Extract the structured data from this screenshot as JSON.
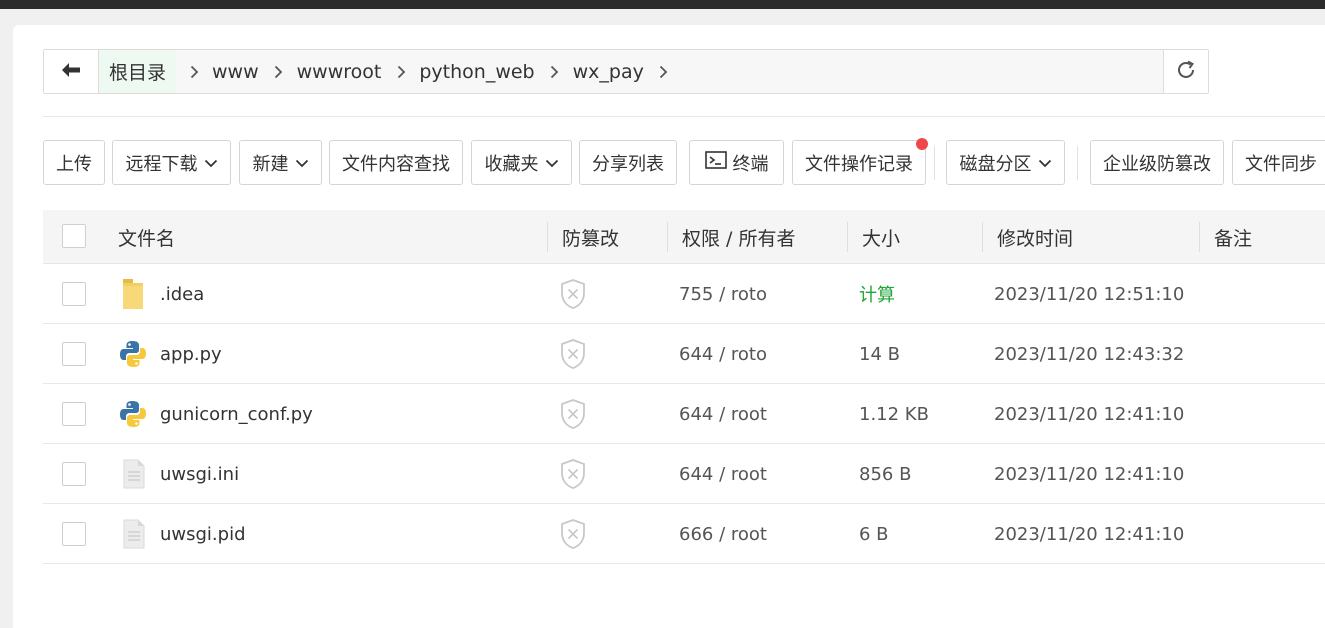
{
  "breadcrumb": {
    "items": [
      "根目录",
      "www",
      "wwwroot",
      "python_web",
      "wx_pay"
    ]
  },
  "toolbar": {
    "upload": "上传",
    "remote_download": "远程下载",
    "new": "新建",
    "content_search": "文件内容查找",
    "favorites": "收藏夹",
    "share_list": "分享列表",
    "terminal": "终端",
    "op_log": "文件操作记录",
    "disk": "磁盘分区",
    "tamper": "企业级防篡改",
    "sync": "文件同步"
  },
  "table": {
    "headers": {
      "name": "文件名",
      "tamper": "防篡改",
      "perm": "权限 / 所有者",
      "size": "大小",
      "mtime": "修改时间",
      "note": "备注"
    },
    "rows": [
      {
        "name": ".idea",
        "icon": "folder-icon",
        "perm": "755 / roto",
        "size": "计算",
        "mtime": "2023/11/20 12:51:10"
      },
      {
        "name": "app.py",
        "icon": "python-file-icon",
        "perm": "644 / roto",
        "size": "14 B",
        "mtime": "2023/11/20 12:43:32"
      },
      {
        "name": "gunicorn_conf.py",
        "icon": "python-file-icon",
        "perm": "644 / root",
        "size": "1.12 KB",
        "mtime": "2023/11/20 12:41:10"
      },
      {
        "name": "uwsgi.ini",
        "icon": "text-file-icon",
        "perm": "644 / root",
        "size": "856 B",
        "mtime": "2023/11/20 12:41:10"
      },
      {
        "name": "uwsgi.pid",
        "icon": "text-file-icon",
        "perm": "666 / root",
        "size": "6 B",
        "mtime": "2023/11/20 12:41:10"
      }
    ]
  },
  "colors": {
    "accent_green": "#20a53a",
    "notify_red": "#f0484a",
    "folder_yellow": "#f7d56a"
  }
}
